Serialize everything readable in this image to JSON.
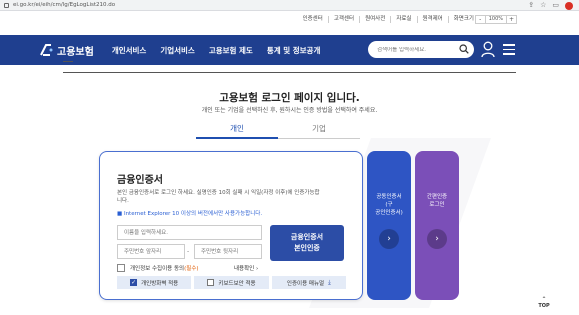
{
  "browser": {
    "url": "ei.go.kr/ei/eih/cm/lg/EgLogList210.do"
  },
  "utility": {
    "links": [
      "인증센터",
      "고객센터",
      "원여사전",
      "자료실",
      "원격제어",
      "화면크기"
    ],
    "zoom_minus": "-",
    "zoom_value": "100%",
    "zoom_plus": "+"
  },
  "nav": {
    "logo_text": "고용보험",
    "menu": [
      "개인서비스",
      "기업서비스",
      "고용보험 제도",
      "통계 및 정보공개"
    ],
    "search_placeholder": "검색어를 입력하세요."
  },
  "page": {
    "title": "고용보험 로그인 페이지 입니다.",
    "subtitle": "개인 또는 기업을 선택하신 후, 원하시는 인증 방법을 선택하여 주세요."
  },
  "tabs": {
    "personal": "개인",
    "business": "기업"
  },
  "card": {
    "title": "금융인증서",
    "desc": "본인 금융인증서로 로그인 하세요. 실명인증 10회 실패 시 익일(자정 이후)에 인증가능합니다.",
    "note": "■ Internet Explorer 10 이상의 버전에서만 사용가능합니다.",
    "name_placeholder": "이름을 입력하세요.",
    "rrn_front_placeholder": "주민번호 앞자리",
    "rrn_back_placeholder": "주민번호 뒷자리",
    "dash": "-",
    "button_line1": "금융인증서",
    "button_line2": "본인인증",
    "consent_label": "개인정보 수집이용 동의",
    "consent_required": "(필수)",
    "detail_link": "내용확인 ›",
    "opt_personal_pc": "개인방화벽 적용",
    "opt_keyboard": "키보드보안 적용",
    "opt_manual": "인증이용 매뉴얼"
  },
  "side": {
    "joint_line1": "공동인증서",
    "joint_line2": "(구",
    "joint_line3": "공인인증서)",
    "simple_line1": "간편인증",
    "simple_line2": "로그인"
  },
  "top_button": "TOP"
}
